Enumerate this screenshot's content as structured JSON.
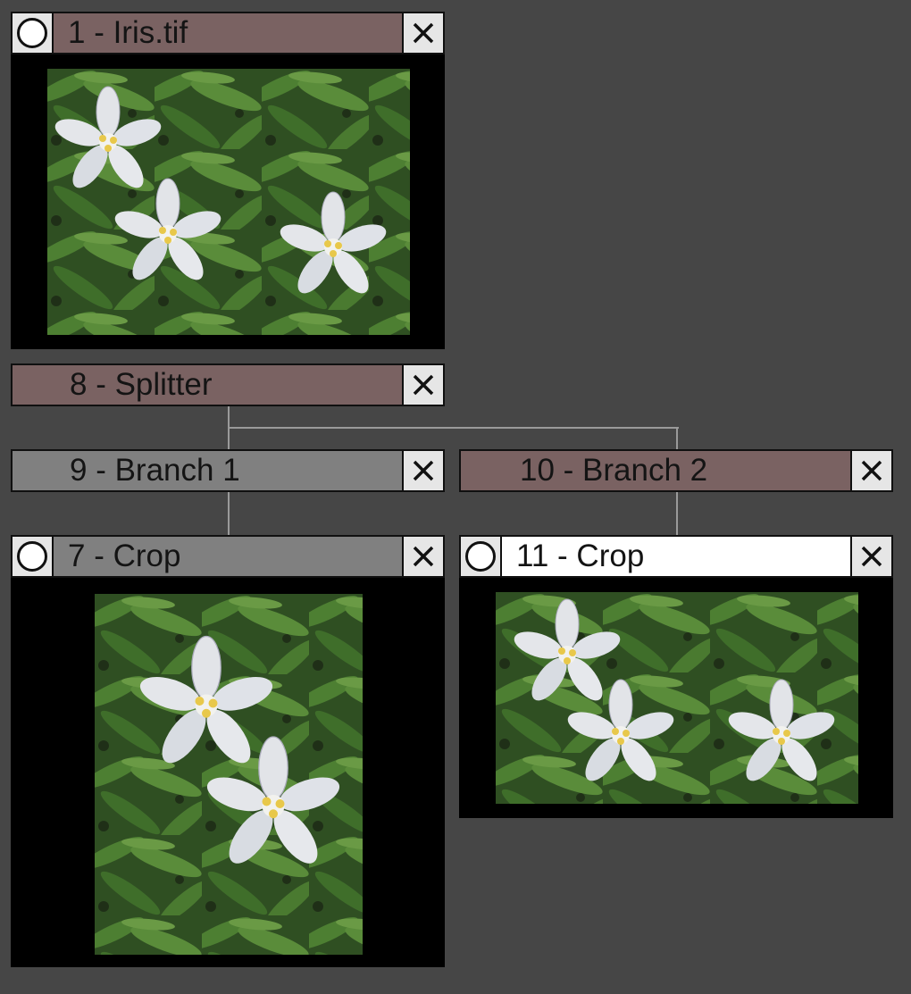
{
  "colors": {
    "background": "#464646",
    "title_active": "#7a6262",
    "title_inactive": "#808080",
    "title_selected": "#ffffff",
    "leaf_green": "#3f6e2a",
    "petal_white": "#e2e4e8",
    "stamen_yellow": "#e8c84a"
  },
  "nodes": {
    "iris": {
      "title": "1 - Iris.tif",
      "icon": "radio-circle-icon",
      "close_icon": "close-x-icon"
    },
    "splitter": {
      "title": "8 - Splitter",
      "close_icon": "close-x-icon"
    },
    "branch1": {
      "title": "9 - Branch 1",
      "close_icon": "close-x-icon"
    },
    "branch2": {
      "title": "10 - Branch 2",
      "close_icon": "close-x-icon"
    },
    "crop7": {
      "title": "7 - Crop",
      "icon": "radio-circle-icon",
      "close_icon": "close-x-icon"
    },
    "crop11": {
      "title": "11 - Crop",
      "icon": "radio-circle-icon",
      "close_icon": "close-x-icon"
    }
  }
}
